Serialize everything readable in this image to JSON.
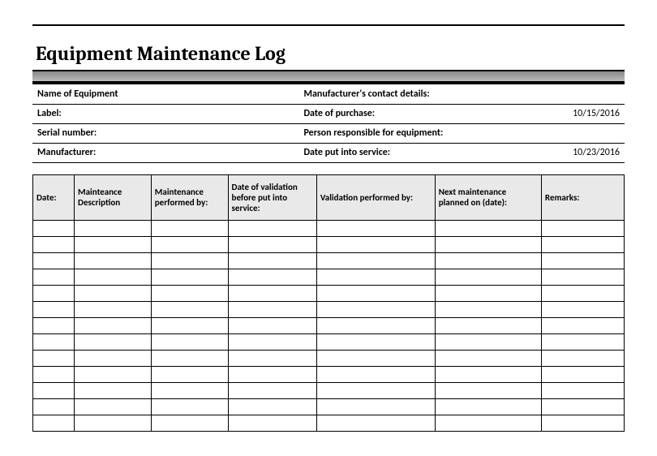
{
  "title": "Equipment Maintenance Log",
  "info": {
    "rows": [
      {
        "left_label": "Name of Equipment",
        "left_value": "",
        "right_label": "Manufacturer's contact details:",
        "right_value": ""
      },
      {
        "left_label": "Label:",
        "left_value": "",
        "right_label": "Date of purchase:",
        "right_value": "10/15/2016"
      },
      {
        "left_label": "Serial number:",
        "left_value": "",
        "right_label": "Person responsible for equipment:",
        "right_value": ""
      },
      {
        "left_label": "Manufacturer:",
        "left_value": "",
        "right_label": "Date put into service:",
        "right_value": "10/23/2016"
      }
    ]
  },
  "log": {
    "headers": [
      "Date:",
      "Mainteance Description",
      "Maintenance performed by:",
      "Date of validation before put into service:",
      "Validation performed by:",
      "Next maintenance planned on (date):",
      "Remarks:"
    ],
    "row_count": 13
  }
}
